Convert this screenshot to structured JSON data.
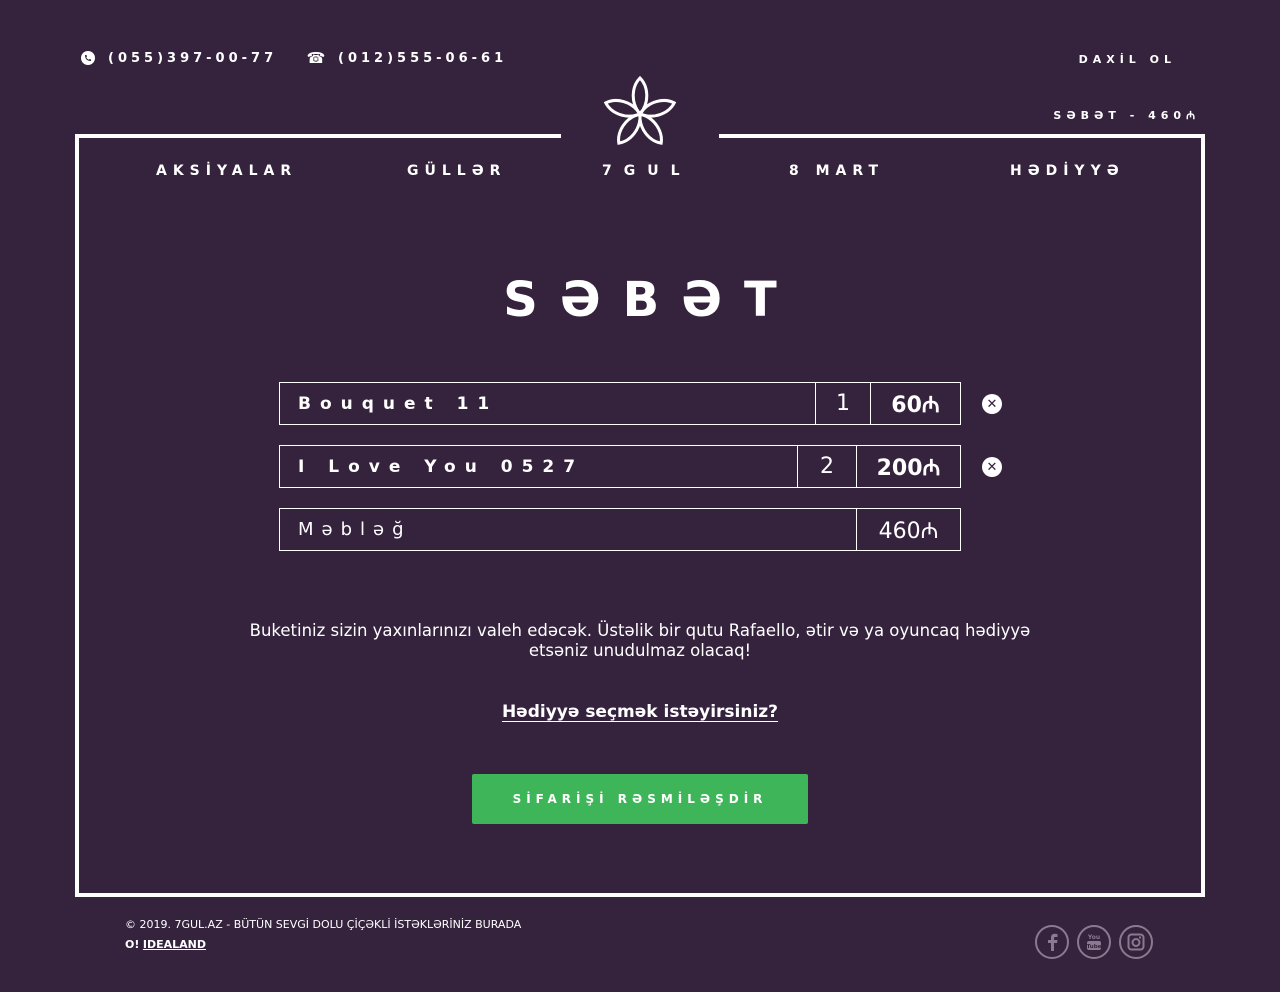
{
  "header": {
    "phone_whatsapp": "(055)397-00-77",
    "phone_landline": "(012)555-06-61",
    "login_label": "DAXİL OL",
    "cart_summary": "SƏBƏT - 460₼"
  },
  "nav": {
    "promotions": "AKSİYALAR",
    "roses": "GÜLLƏR",
    "brand": "7GUL",
    "march8": "8 MART",
    "gifts": "HƏDİYYƏ"
  },
  "page_title": "SƏBƏT",
  "cart": {
    "items": [
      {
        "name": "Bouquet 11",
        "qty": "1",
        "price": "60₼"
      },
      {
        "name": "I Love You 0527",
        "qty": "2",
        "price": "200₼"
      }
    ],
    "total_label": "Məbləğ",
    "total_value": "460₼"
  },
  "message": "Buketiniz sizin yaxınlarınızı valeh edəcək. Üstəlik bir qutu Rafaello, ətir və ya oyuncaq hədiyyə etsəniz unudulmaz olacaq!",
  "gift_link": "Hədiyyə seçmək istəyirsiniz?",
  "order_button": "SİFARİŞİ RƏSMİLƏŞDİR",
  "footer": {
    "copyright": "© 2019. 7GUL.AZ - BÜTÜN SEVGİ DOLU ÇİÇƏKLİ İSTƏKLƏRİNİZ BURADA",
    "credit_prefix": "O!",
    "credit_link": "IDEALAND"
  },
  "icons": {
    "whatsapp": "whatsapp-icon",
    "phone": "phone-icon",
    "remove": "close-circle-icon",
    "facebook": "facebook-icon",
    "youtube": "youtube-icon",
    "instagram": "instagram-icon"
  },
  "colors": {
    "background": "#35223d",
    "order_button": "#3fb55a",
    "social_icons": "#8a7a91"
  }
}
